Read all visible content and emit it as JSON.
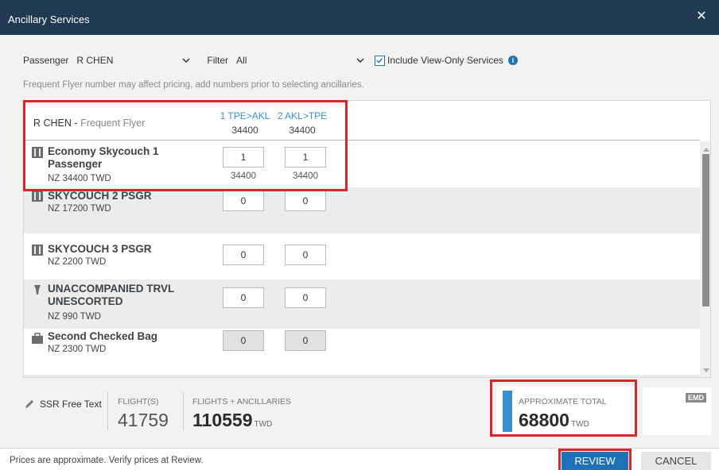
{
  "window": {
    "title": "Ancillary Services",
    "close_label": "✕"
  },
  "filters": {
    "passenger_label": "Passenger",
    "passenger_value": "R CHEN",
    "filter_label": "Filter",
    "filter_value": "All",
    "include_view_only": {
      "label": "Include View-Only Services",
      "checked": true
    }
  },
  "note": "Frequent Flyer number may affect pricing, add numbers prior to selecting ancillaries.",
  "header": {
    "passenger_name": "R CHEN",
    "separator": "-",
    "passenger_type": "Frequent Flyer",
    "legs": [
      {
        "code": "1 TPE>AKL",
        "amount": "34400"
      },
      {
        "code": "2 AKL>TPE",
        "amount": "34400"
      }
    ]
  },
  "services": [
    {
      "icon": "seat-icon",
      "name": "Economy Skycouch 1 Passenger",
      "price": "NZ 34400 TWD",
      "qty": [
        "1",
        "1"
      ],
      "subtotals": [
        "34400",
        "34400"
      ],
      "enabled": true
    },
    {
      "icon": "seat-icon",
      "name": "SKYCOUCH 2 PSGR",
      "price": "NZ 17200 TWD",
      "qty": [
        "0",
        "0"
      ],
      "subtotals": [
        "",
        ""
      ],
      "enabled": true
    },
    {
      "icon": "seat-icon",
      "name": "SKYCOUCH 3 PSGR",
      "price": "NZ 2200 TWD",
      "qty": [
        "0",
        "0"
      ],
      "subtotals": [
        "",
        ""
      ],
      "enabled": true
    },
    {
      "icon": "child-icon",
      "name": "UNACCOMPANIED TRVL UNESCORTED",
      "price": "NZ 990 TWD",
      "qty": [
        "0",
        "0"
      ],
      "subtotals": [
        "",
        ""
      ],
      "enabled": true
    },
    {
      "icon": "bag-icon",
      "name": "Second Checked Bag",
      "price": "NZ 2300 TWD",
      "qty": [
        "0",
        "0"
      ],
      "subtotals": [
        "",
        ""
      ],
      "enabled": false
    }
  ],
  "summary": {
    "ssr_label": "SSR Free Text",
    "flights_label": "FLIGHT(S)",
    "flights_value": "41759",
    "combined_label": "FLIGHTS + ANCILLARIES",
    "combined_value": "110559",
    "combined_currency": "TWD",
    "total_label": "APPROXIMATE TOTAL",
    "total_value": "68800",
    "total_currency": "TWD",
    "emd_badge": "EMD"
  },
  "footer": {
    "message": "Prices are approximate. Verify prices at Review.",
    "review_label": "REVIEW",
    "cancel_label": "CANCEL"
  },
  "colors": {
    "title_bar": "#1f3a52",
    "accent": "#1f72b8",
    "leg_header": "#3a8fd0",
    "highlight": "#d6262c"
  }
}
